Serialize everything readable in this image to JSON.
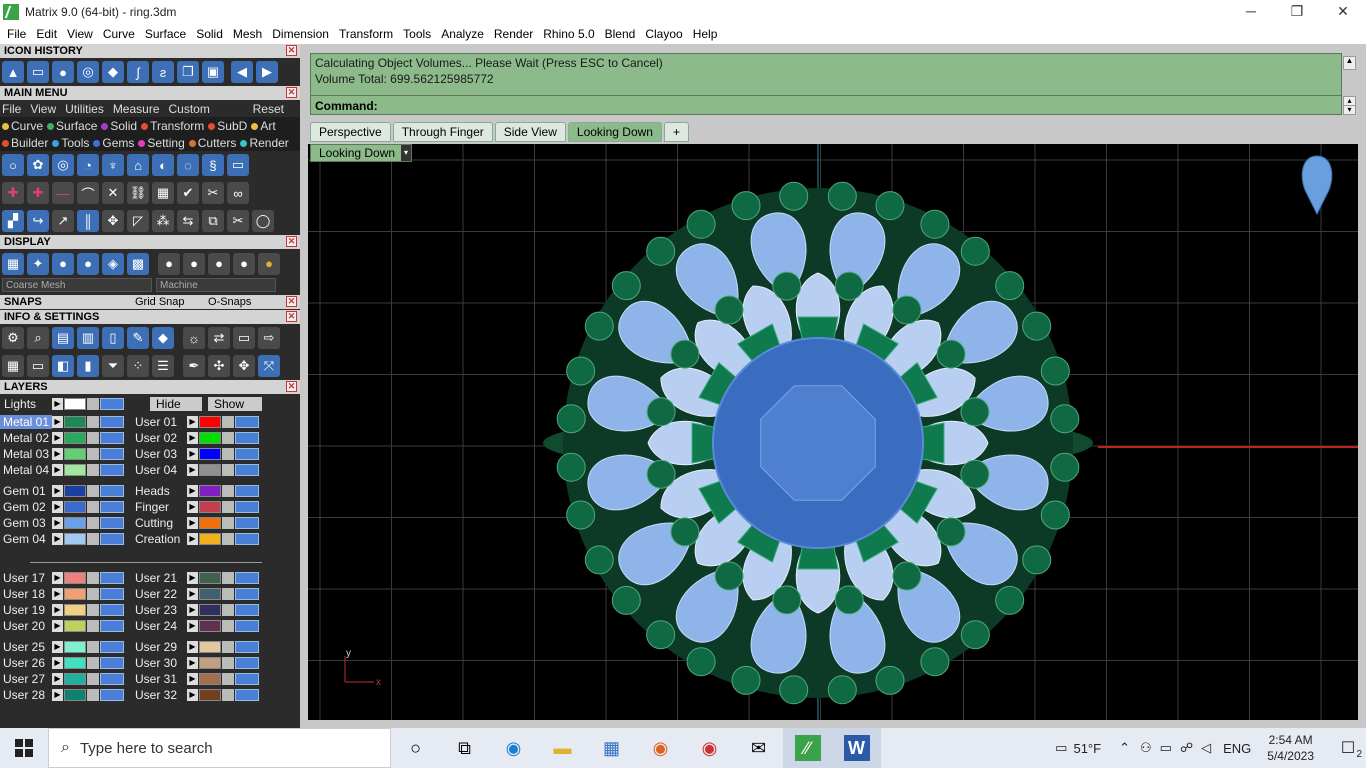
{
  "window": {
    "title": "Matrix 9.0 (64-bit) - ring.3dm",
    "minimize": "─",
    "restore": "❐",
    "close": "✕"
  },
  "menubar": [
    "File",
    "Edit",
    "View",
    "Curve",
    "Surface",
    "Solid",
    "Mesh",
    "Dimension",
    "Transform",
    "Tools",
    "Analyze",
    "Render",
    "Rhino 5.0",
    "Blend",
    "Clayoo",
    "Help"
  ],
  "panels": {
    "icon_history": "ICON HISTORY",
    "main_menu": "MAIN MENU",
    "display": "DISPLAY",
    "snaps": "SNAPS",
    "info_settings": "INFO & SETTINGS",
    "layers": "LAYERS"
  },
  "main_menu_bar": [
    "File",
    "View",
    "Utilities",
    "Measure",
    "Custom"
  ],
  "main_menu_reset": "Reset",
  "main_menu_row1": [
    {
      "label": "Curve",
      "color": "#e8c040"
    },
    {
      "label": "Surface",
      "color": "#40b060"
    },
    {
      "label": "Solid",
      "color": "#a040c0"
    },
    {
      "label": "Transform",
      "color": "#e05030"
    },
    {
      "label": "SubD",
      "color": "#e05030"
    },
    {
      "label": "Art",
      "color": "#e8c040"
    }
  ],
  "main_menu_row2": [
    {
      "label": "Builder",
      "color": "#e05030"
    },
    {
      "label": "Tools",
      "color": "#40a0e0"
    },
    {
      "label": "Gems",
      "color": "#4070e0"
    },
    {
      "label": "Setting",
      "color": "#e040c0"
    },
    {
      "label": "Cutters",
      "color": "#e07030"
    },
    {
      "label": "Render",
      "color": "#40c0c0"
    }
  ],
  "display": {
    "mesh_select": "Coarse Mesh",
    "material_select": "Machine"
  },
  "snaps": {
    "grid_snap": "Grid Snap",
    "o_snaps": "O-Snaps"
  },
  "layers_header": {
    "lights": "Lights",
    "hide": "Hide",
    "show": "Show"
  },
  "layers_left": [
    {
      "name": "Metal 01",
      "color": "#1a8a5a",
      "active": true
    },
    {
      "name": "Metal 02",
      "color": "#2aa860"
    },
    {
      "name": "Metal 03",
      "color": "#60d070"
    },
    {
      "name": "Metal 04",
      "color": "#a0e8a0"
    },
    {
      "name": "Gem 01",
      "color": "#1a40a0"
    },
    {
      "name": "Gem 02",
      "color": "#3a6ad0"
    },
    {
      "name": "Gem 03",
      "color": "#6aa0e8"
    },
    {
      "name": "Gem 04",
      "color": "#a0c8f0"
    },
    {
      "name": "User 17",
      "color": "#f08080"
    },
    {
      "name": "User 18",
      "color": "#f0a070"
    },
    {
      "name": "User 19",
      "color": "#f0d080"
    },
    {
      "name": "User 20",
      "color": "#c0d060"
    },
    {
      "name": "User 25",
      "color": "#80f0d0"
    },
    {
      "name": "User 26",
      "color": "#40e0c0"
    },
    {
      "name": "User 27",
      "color": "#20b0a0"
    },
    {
      "name": "User 28",
      "color": "#108070"
    }
  ],
  "layers_right": [
    {
      "name": "User 01",
      "color": "#ff0000"
    },
    {
      "name": "User 02",
      "color": "#00e000"
    },
    {
      "name": "User 03",
      "color": "#0000ff"
    },
    {
      "name": "User 04",
      "color": "#909090"
    },
    {
      "name": "Heads",
      "color": "#8020c0"
    },
    {
      "name": "Finger",
      "color": "#c04050"
    },
    {
      "name": "Cutting",
      "color": "#f07010"
    },
    {
      "name": "Creation",
      "color": "#f0b020"
    },
    {
      "name": "User 21",
      "color": "#406050"
    },
    {
      "name": "User 22",
      "color": "#406070"
    },
    {
      "name": "User 23",
      "color": "#303060"
    },
    {
      "name": "User 24",
      "color": "#603050"
    },
    {
      "name": "User 29",
      "color": "#e0c8a0"
    },
    {
      "name": "User 30",
      "color": "#c0a080"
    },
    {
      "name": "User 31",
      "color": "#a07050"
    },
    {
      "name": "User 32",
      "color": "#704020"
    }
  ],
  "command": {
    "line1": "Calculating Object Volumes... Please Wait (Press ESC to Cancel)",
    "line2": "Volume Total: 699.562125985772",
    "prompt": "Command:"
  },
  "viewport_tabs": [
    "Perspective",
    "Through Finger",
    "Side View",
    "Looking Down"
  ],
  "active_tab": "Looking Down",
  "add_tab": "+",
  "viewport_selector": "Looking Down",
  "axis": {
    "x": "x",
    "y": "y"
  },
  "taskbar": {
    "search_placeholder": "Type here to search",
    "temperature": "51°F",
    "language": "ENG",
    "time": "2:54 AM",
    "date": "5/4/2023",
    "notifications": "2"
  }
}
